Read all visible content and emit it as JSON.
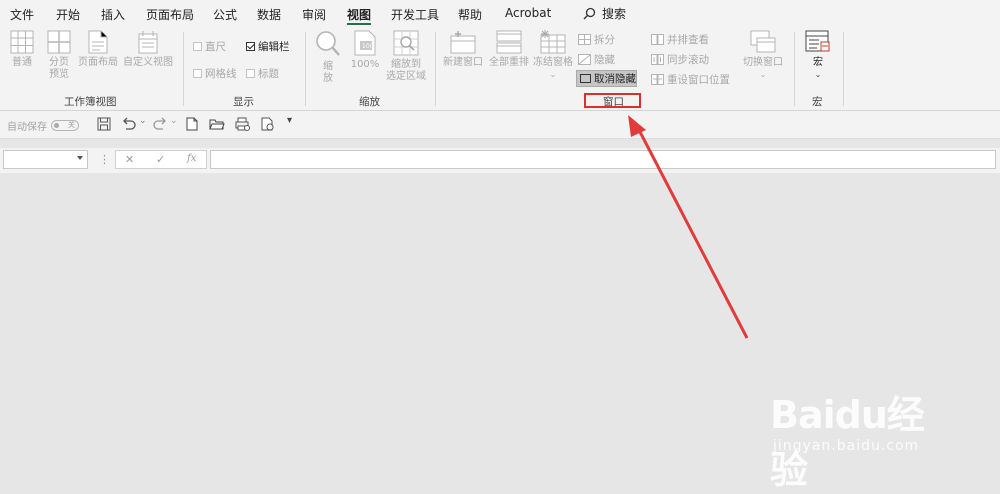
{
  "menu": {
    "items": [
      "文件",
      "开始",
      "插入",
      "页面布局",
      "公式",
      "数据",
      "审阅",
      "视图",
      "开发工具",
      "帮助",
      "Acrobat"
    ],
    "active_index": 7,
    "search_label": "搜索"
  },
  "ribbon": {
    "workbook_views": {
      "label": "工作簿视图",
      "buttons": [
        {
          "line1": "普通",
          "line2": ""
        },
        {
          "line1": "分页",
          "line2": "预览"
        },
        {
          "line1": "页面布局",
          "line2": ""
        },
        {
          "line1": "自定义视图",
          "line2": ""
        }
      ]
    },
    "show": {
      "label": "显示",
      "ruler": "直尺",
      "formula_bar": "编辑栏",
      "gridlines": "网格线",
      "headings": "标题",
      "formula_bar_checked": true
    },
    "zoom": {
      "label": "缩放",
      "zoom": {
        "line1": "缩",
        "line2": "放"
      },
      "zoom100": "100%",
      "zoom_selection": {
        "line1": "缩放到",
        "line2": "选定区域"
      }
    },
    "window": {
      "label": "窗口",
      "new_window": "新建窗口",
      "arrange_all": "全部重排",
      "freeze_panes": "冻结窗格",
      "split": "拆分",
      "hide": "隐藏",
      "unhide": "取消隐藏",
      "view_side_by_side": "并排查看",
      "sync_scroll": "同步滚动",
      "reset_position": "重设窗口位置",
      "switch_windows": "切换窗口"
    },
    "macros": {
      "label": "宏",
      "button": "宏"
    }
  },
  "qat": {
    "autosave_label": "自动保存",
    "autosave_state": "关"
  },
  "formula_bar": {
    "name_box_value": "",
    "fx_label": "fx",
    "formula_value": ""
  },
  "watermark": {
    "brand": "Baidu经验",
    "url": "jingyan.baidu.com"
  },
  "colors": {
    "accent_green": "#217346",
    "highlight_red": "#d9312f",
    "arrow_red": "#e03c3c"
  }
}
